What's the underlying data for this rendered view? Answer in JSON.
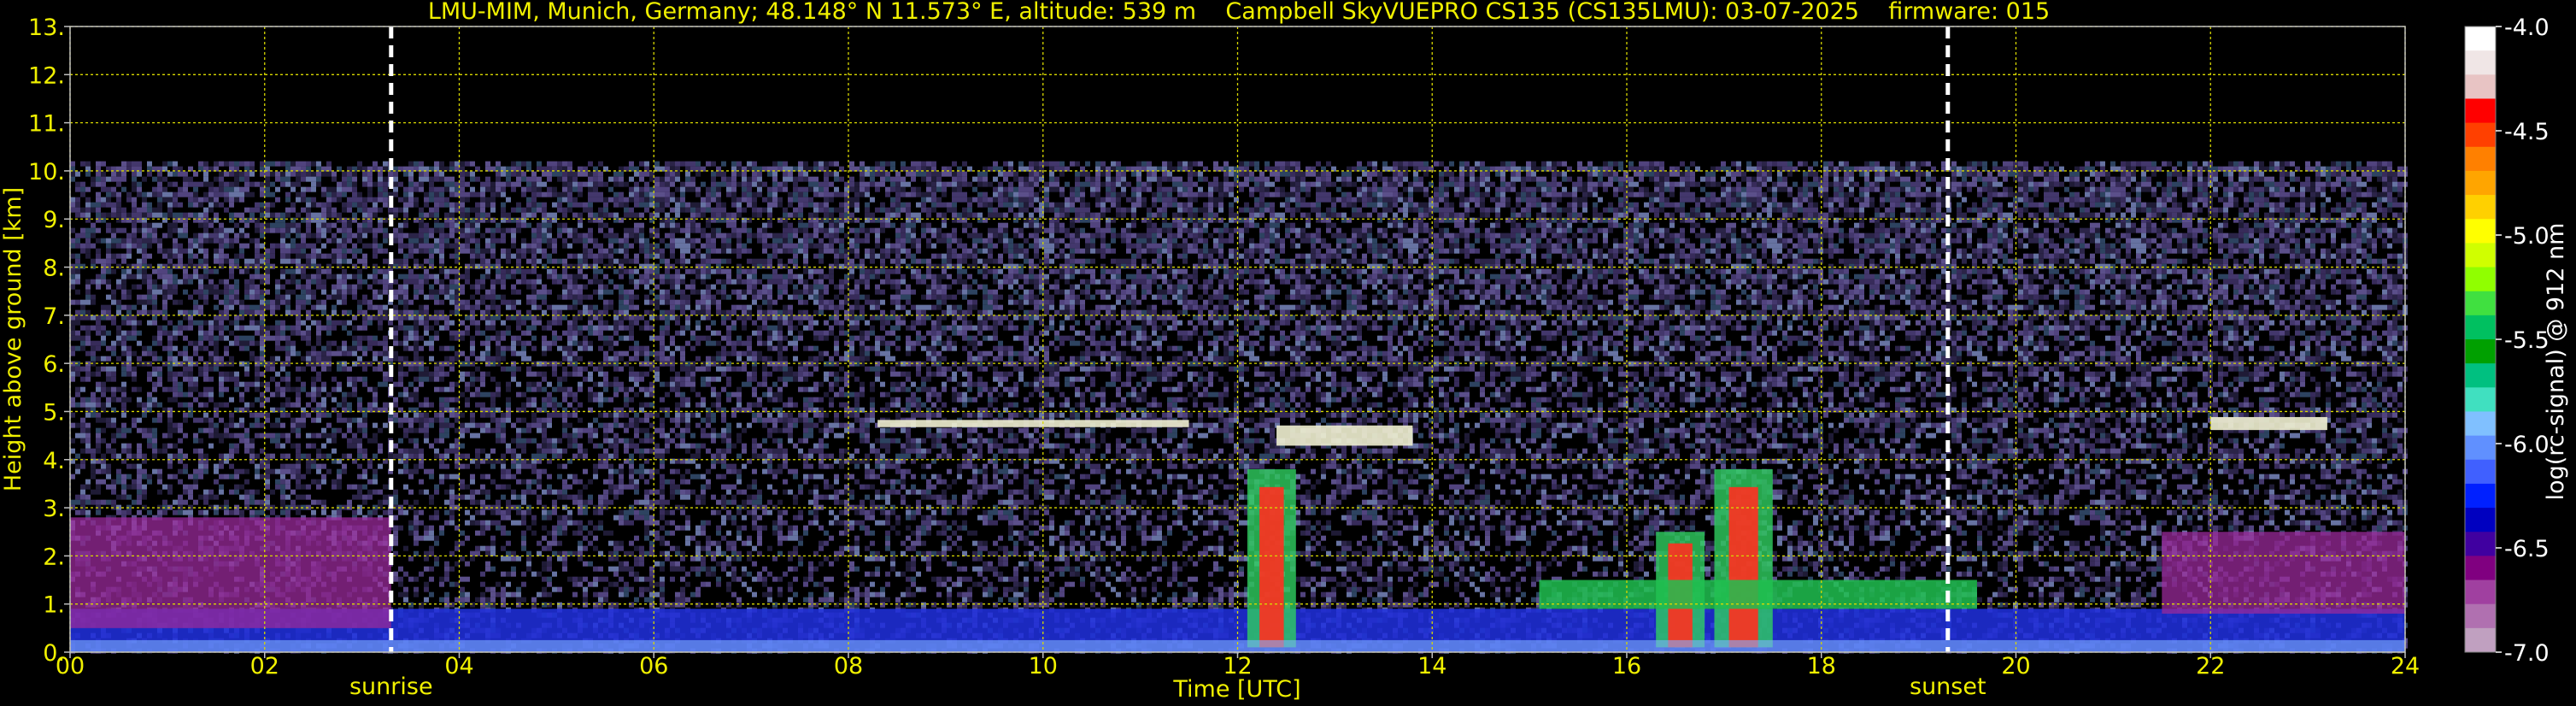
{
  "chart_data": {
    "type": "heatmap",
    "title": "LMU-MIM, Munich, Germany; 48.148° N 11.573° E, altitude: 539 m    Campbell SkyVUEPRO CS135 (CS135LMU): 03-07-2025    firmware: 015",
    "xlabel": "Time [UTC]",
    "ylabel": "Height above ground [km]",
    "xlim": [
      0,
      24
    ],
    "ylim": [
      0,
      13
    ],
    "x_ticks": [
      "00",
      "02",
      "04",
      "06",
      "08",
      "10",
      "12",
      "14",
      "16",
      "18",
      "20",
      "22",
      "24"
    ],
    "y_ticks": [
      "0.",
      "1.",
      "2.",
      "3.",
      "4.",
      "5.",
      "6.",
      "7.",
      "8.",
      "9.",
      "10.",
      "11.",
      "12.",
      "13."
    ],
    "grid": true,
    "signal_top_km": 10.2,
    "markers": [
      {
        "label": "sunrise",
        "time_h": 3.3
      },
      {
        "label": "sunset",
        "time_h": 19.3
      }
    ],
    "colorbar": {
      "label": "log(rc-signal) @ 912 nm",
      "range": [
        -7.0,
        -4.0
      ],
      "ticks": [
        "-4.0",
        "-4.5",
        "-5.0",
        "-5.5",
        "-6.0",
        "-6.5",
        "-7.0"
      ],
      "colors": [
        "#ffffff",
        "#f0e6e6",
        "#e8c4c4",
        "#ff0000",
        "#ff4000",
        "#ff8000",
        "#ffa500",
        "#ffd000",
        "#ffff00",
        "#d0ff00",
        "#90ff00",
        "#40e040",
        "#00c060",
        "#00a000",
        "#00c080",
        "#40e0c0",
        "#80c0ff",
        "#6090ff",
        "#4060ff",
        "#0020ff",
        "#0000c0",
        "#4000a0",
        "#800080",
        "#a040a0",
        "#b070b0",
        "#c0a0c0"
      ]
    },
    "features": [
      {
        "kind": "boundary_layer",
        "time_h": [
          0,
          24
        ],
        "height_km": [
          0,
          0.9
        ]
      },
      {
        "kind": "residual_layer",
        "time_h": [
          0,
          3.3
        ],
        "height_km": [
          0.5,
          2.8
        ]
      },
      {
        "kind": "residual_layer",
        "time_h": [
          21.5,
          24
        ],
        "height_km": [
          0.8,
          2.5
        ]
      },
      {
        "kind": "cloud_layer",
        "time_h": [
          8.3,
          11.5
        ],
        "height_km": [
          4.5,
          5.0
        ]
      },
      {
        "kind": "cloud_layer",
        "time_h": [
          12.4,
          13.8
        ],
        "height_km": [
          3.8,
          5.2
        ]
      },
      {
        "kind": "cloud_layer",
        "time_h": [
          22.0,
          23.2
        ],
        "height_km": [
          4.3,
          5.2
        ]
      },
      {
        "kind": "convective_cloud",
        "time_h": [
          12.1,
          12.6
        ],
        "height_km": [
          0.1,
          3.8
        ]
      },
      {
        "kind": "convective_cloud",
        "time_h": [
          16.3,
          16.8
        ],
        "height_km": [
          0.1,
          2.5
        ]
      },
      {
        "kind": "convective_cloud",
        "time_h": [
          16.9,
          17.5
        ],
        "height_km": [
          0.1,
          3.8
        ]
      },
      {
        "kind": "cloud_base",
        "time_h": [
          15.1,
          19.6
        ],
        "height_km": [
          0.9,
          1.5
        ]
      }
    ]
  }
}
